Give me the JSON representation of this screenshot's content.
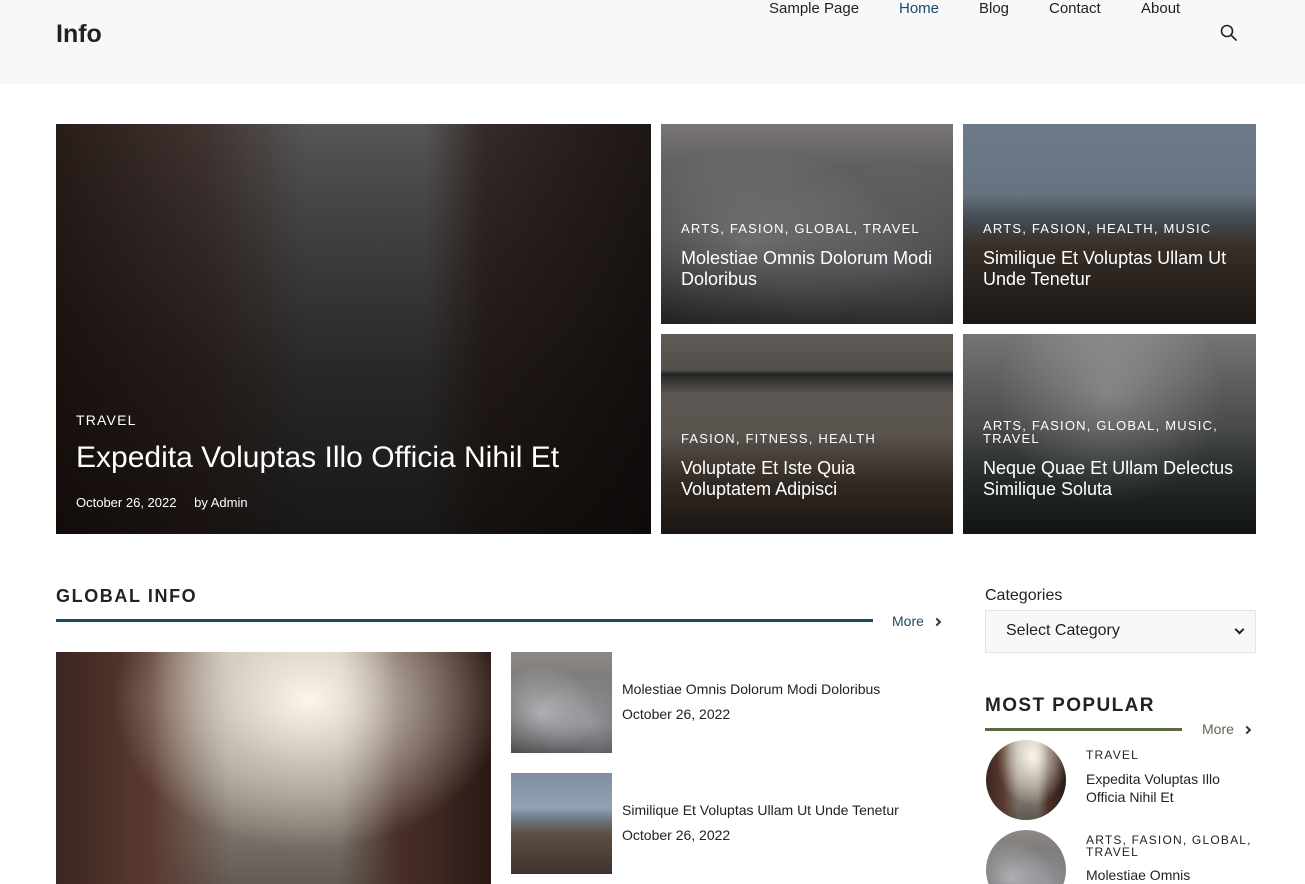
{
  "site": {
    "logo": "Info"
  },
  "nav": {
    "items": [
      {
        "label": "Sample Page"
      },
      {
        "label": "Home"
      },
      {
        "label": "Blog"
      },
      {
        "label": "Contact"
      },
      {
        "label": "About"
      }
    ],
    "search_icon": "search-icon"
  },
  "hero": {
    "main": {
      "categories": "TRAVEL",
      "title": "Expedita Voluptas Illo Officia Nihil Et",
      "date": "October 26, 2022",
      "author": "by Admin"
    },
    "tiles": [
      {
        "categories": "ARTS, FASION, GLOBAL, TRAVEL",
        "title": "Molestiae Omnis Dolorum Modi Doloribus"
      },
      {
        "categories": "ARTS, FASION, HEALTH, MUSIC",
        "title": "Similique Et Voluptas Ullam Ut Unde Tenetur"
      },
      {
        "categories": "FASION, FITNESS, HEALTH",
        "title": "Voluptate Et Iste Quia Voluptatem Adipisci"
      },
      {
        "categories": "ARTS, FASION, GLOBAL, MUSIC, TRAVEL",
        "title": "Neque Quae Et Ullam Delectus Similique Soluta"
      }
    ]
  },
  "global_info": {
    "heading": "GLOBAL INFO",
    "more": "More",
    "list": [
      {
        "title": "Molestiae Omnis Dolorum Modi Doloribus",
        "date": "October 26, 2022"
      },
      {
        "title": "Similique Et Voluptas Ullam Ut Unde Tenetur",
        "date": "October 26, 2022"
      }
    ]
  },
  "sidebar": {
    "categories_label": "Categories",
    "select_value": "Select Category",
    "popular_heading": "MOST POPULAR",
    "more": "More",
    "popular": [
      {
        "categories": "TRAVEL",
        "title": "Expedita Voluptas Illo Officia Nihil Et"
      },
      {
        "categories": "ARTS, FASION, GLOBAL, TRAVEL",
        "title": "Molestiae Omnis"
      }
    ]
  },
  "colors": {
    "accent": "#1b4b67",
    "popular_line": "#5b6a46",
    "header_bg": "#f7f8f9"
  }
}
